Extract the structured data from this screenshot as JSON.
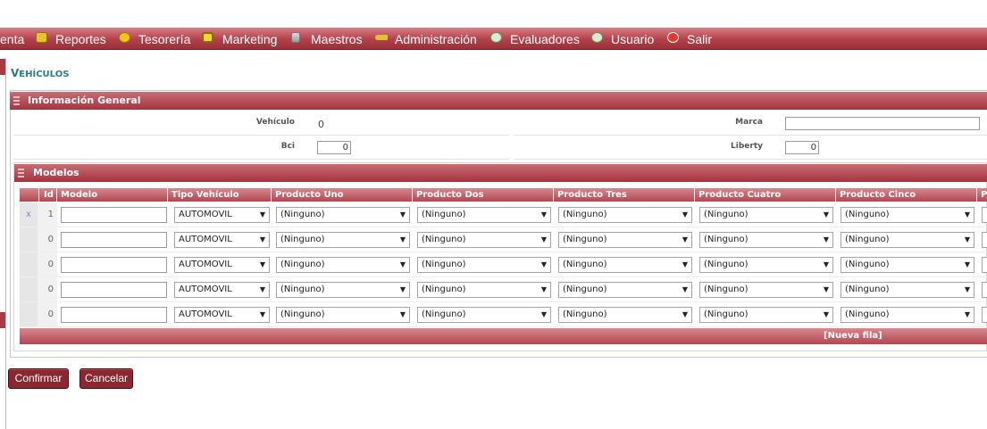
{
  "menu": {
    "items": [
      {
        "label": "enta",
        "icon": "none"
      },
      {
        "label": "Reportes",
        "icon": "folder-icon"
      },
      {
        "label": "Tesorería",
        "icon": "coin-icon"
      },
      {
        "label": "Marketing",
        "icon": "monitor-icon"
      },
      {
        "label": "Maestros",
        "icon": "database-icon"
      },
      {
        "label": "Administración",
        "icon": "key-icon"
      },
      {
        "label": "Evaluadores",
        "icon": "user-group-icon"
      },
      {
        "label": "Usuario",
        "icon": "user-icon"
      },
      {
        "label": "Salir",
        "icon": "exit-icon"
      }
    ]
  },
  "page": {
    "title_first": "V",
    "title_rest": "EHÍCULOS"
  },
  "general": {
    "header": "Información General",
    "vehiculo_label": "Vehículo",
    "vehiculo_value": "0",
    "marca_label": "Marca",
    "marca_value": "",
    "bci_label": "Bci",
    "bci_value": "0",
    "liberty_label": "Liberty",
    "liberty_value": "0"
  },
  "modelos": {
    "header": "Modelos",
    "columns": [
      "Id",
      "Modelo",
      "Tipo Vehículo",
      "Producto Uno",
      "Producto Dos",
      "Producto Tres",
      "Producto Cuatro",
      "Producto Cinco",
      "P"
    ],
    "rows": [
      {
        "delete": "x",
        "id": "1",
        "modelo": "",
        "tipo": "AUTOMOVIL",
        "p1": "(Ninguno)",
        "p2": "(Ninguno)",
        "p3": "(Ninguno)",
        "p4": "(Ninguno)",
        "p5": "(Ninguno)"
      },
      {
        "delete": "",
        "id": "0",
        "modelo": "",
        "tipo": "AUTOMOVIL",
        "p1": "(Ninguno)",
        "p2": "(Ninguno)",
        "p3": "(Ninguno)",
        "p4": "(Ninguno)",
        "p5": "(Ninguno)"
      },
      {
        "delete": "",
        "id": "0",
        "modelo": "",
        "tipo": "AUTOMOVIL",
        "p1": "(Ninguno)",
        "p2": "(Ninguno)",
        "p3": "(Ninguno)",
        "p4": "(Ninguno)",
        "p5": "(Ninguno)"
      },
      {
        "delete": "",
        "id": "0",
        "modelo": "",
        "tipo": "AUTOMOVIL",
        "p1": "(Ninguno)",
        "p2": "(Ninguno)",
        "p3": "(Ninguno)",
        "p4": "(Ninguno)",
        "p5": "(Ninguno)"
      },
      {
        "delete": "",
        "id": "0",
        "modelo": "",
        "tipo": "AUTOMOVIL",
        "p1": "(Ninguno)",
        "p2": "(Ninguno)",
        "p3": "(Ninguno)",
        "p4": "(Ninguno)",
        "p5": "(Ninguno)"
      }
    ],
    "new_row_label": "[Nueva fila]"
  },
  "actions": {
    "confirm_label": "Confirmar",
    "cancel_label": "Cancelar"
  },
  "colors": {
    "accent": "#a83a45",
    "title": "#2a7a8e",
    "button": "#8a2731"
  }
}
